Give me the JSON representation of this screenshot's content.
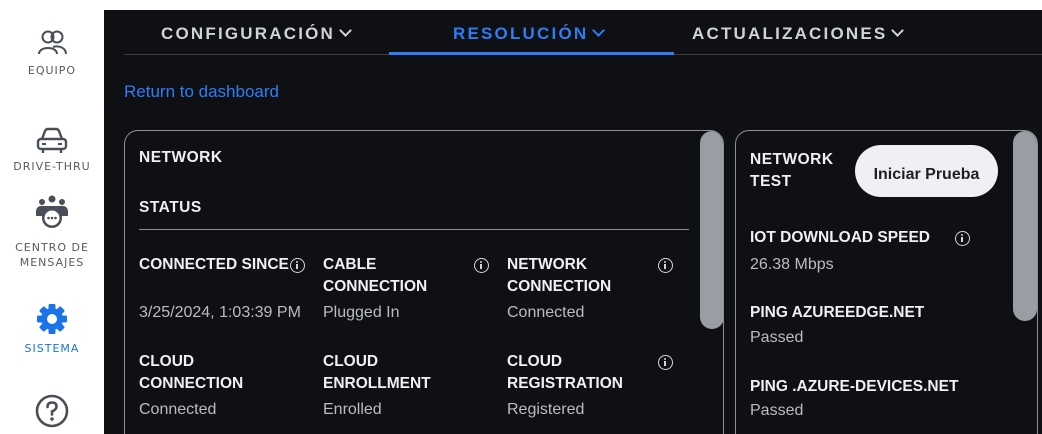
{
  "sidebar": {
    "items": [
      {
        "label": "EQUIPO",
        "icon": "team-icon"
      },
      {
        "label": "DRIVE-THRU",
        "icon": "car-icon"
      },
      {
        "label": "CENTRO DE MENSAJES",
        "icon": "chat-group-icon"
      },
      {
        "label": "SISTEMA",
        "icon": "gear-icon",
        "active": true
      },
      {
        "label": "",
        "icon": "help-icon"
      }
    ],
    "active_color": "#1a73e8"
  },
  "nav": {
    "tabs": [
      {
        "label": "CONFIGURACIÓN"
      },
      {
        "label": "RESOLUCIÓN",
        "active": true
      },
      {
        "label": "ACTUALIZACIONES"
      }
    ],
    "accent_color": "#2f7df6"
  },
  "return_link": "Return to dashboard",
  "network_card": {
    "title": "NETWORK",
    "section": "STATUS",
    "fields": [
      {
        "label": "CONNECTED SINCE",
        "value": "3/25/2024, 1:03:39 PM",
        "info": true
      },
      {
        "label": "CABLE CONNECTION",
        "value": "Plugged In",
        "info": true
      },
      {
        "label": "NETWORK CONNECTION",
        "value": "Connected",
        "info": true
      },
      {
        "label": "CLOUD CONNECTION",
        "value": "Connected",
        "info": false
      },
      {
        "label": "CLOUD ENROLLMENT",
        "value": "Enrolled",
        "info": false
      },
      {
        "label": "CLOUD REGISTRATION",
        "value": "Registered",
        "info": true
      }
    ]
  },
  "network_test_card": {
    "title": "NETWORK TEST",
    "start_button": "Iniciar Prueba",
    "results": [
      {
        "label": "IOT DOWNLOAD SPEED",
        "value": "26.38 Mbps",
        "info": true
      },
      {
        "label": "PING AZUREEDGE.NET",
        "value": "Passed"
      },
      {
        "label": "PING .AZURE-DEVICES.NET",
        "value": "Passed"
      }
    ]
  }
}
